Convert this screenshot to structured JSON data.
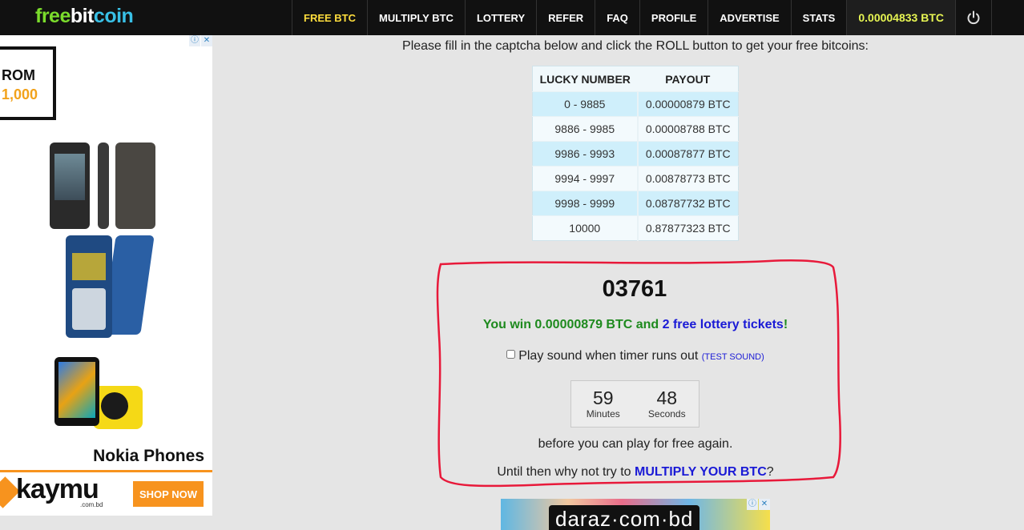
{
  "logo": {
    "part1": "free",
    "part2": "bit",
    "part3": "coin"
  },
  "nav": {
    "items": [
      {
        "label": "FREE BTC",
        "active": true
      },
      {
        "label": "MULTIPLY BTC"
      },
      {
        "label": "LOTTERY"
      },
      {
        "label": "REFER"
      },
      {
        "label": "FAQ"
      },
      {
        "label": "PROFILE"
      },
      {
        "label": "ADVERTISE"
      },
      {
        "label": "STATS"
      }
    ],
    "balance": "0.00004833 BTC",
    "power_icon": "power-icon"
  },
  "left_ad": {
    "promo_line1": "ROM",
    "promo_line2": "1,000",
    "caption": "Nokia Phones",
    "brand": "kaymu",
    "brand_sub": ".com.bd",
    "cta": "SHOP NOW",
    "adchoice_info": "ⓘ",
    "adchoice_close": "✕"
  },
  "main": {
    "instruction": "Please fill in the captcha below and click the ROLL button to get your free bitcoins:",
    "table": {
      "headers": [
        "LUCKY NUMBER",
        "PAYOUT"
      ],
      "rows": [
        [
          "0 - 9885",
          "0.00000879 BTC"
        ],
        [
          "9886 - 9985",
          "0.00008788 BTC"
        ],
        [
          "9986 - 9993",
          "0.00087877 BTC"
        ],
        [
          "9994 - 9997",
          "0.00878773 BTC"
        ],
        [
          "9998 - 9999",
          "0.08787732 BTC"
        ],
        [
          "10000",
          "0.87877323 BTC"
        ]
      ]
    },
    "roll_number": "03761",
    "win_prefix": "You win 0.00000879 BTC and ",
    "win_tickets": "2 free lottery tickets",
    "win_suffix": "!",
    "sound_label": "Play sound when timer runs out",
    "test_sound": "(TEST SOUND)",
    "timer": {
      "minutes": "59",
      "minutes_label": "Minutes",
      "seconds": "48",
      "seconds_label": "Seconds"
    },
    "before_text": "before you can play for free again.",
    "until_prefix": "Until then why not try to ",
    "until_link": "MULTIPLY YOUR BTC",
    "until_suffix": "?"
  },
  "bottom_ad": {
    "brand": "daraz·com·bd"
  },
  "colors": {
    "accent_red": "#e8193a",
    "nav_bg": "#111111",
    "balance": "#e7f553",
    "link_blue": "#1a1ad6",
    "win_green": "#1e8a1e"
  }
}
